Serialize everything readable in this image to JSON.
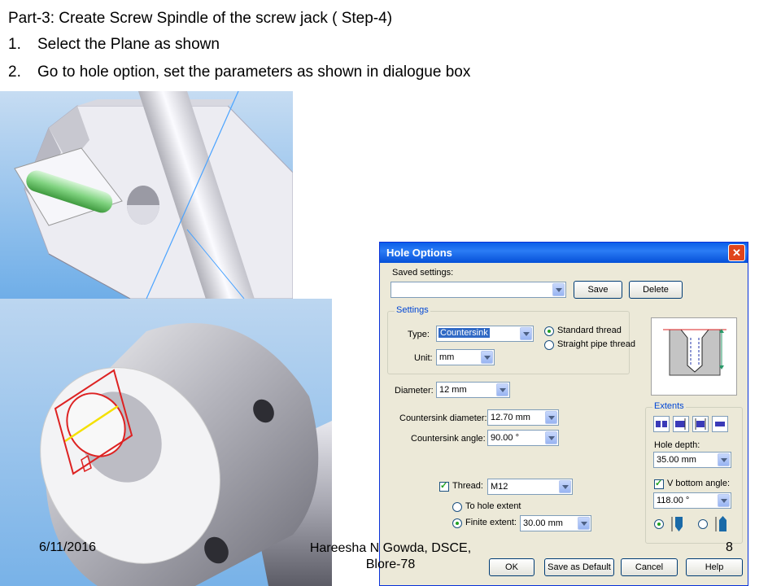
{
  "slide": {
    "title": "Part-3: Create Screw Spindle of the screw jack ( Step-4)",
    "steps": [
      {
        "number": "1.",
        "text": "Select the Plane as shown"
      },
      {
        "number": "2.",
        "text": "Go to hole option, set the parameters as shown in dialogue box"
      }
    ]
  },
  "dialog": {
    "title": "Hole Options",
    "close_glyph": "✕",
    "saved_settings_label": "Saved settings:",
    "saved_settings_value": "",
    "save_button": "Save",
    "delete_button": "Delete",
    "settings_group": "Settings",
    "type_label": "Type:",
    "type_value": "Countersink",
    "standard_thread": "Standard thread",
    "straight_pipe_thread": "Straight pipe thread",
    "thread_mode_selected": "Standard thread",
    "unit_label": "Unit:",
    "unit_value": "mm",
    "diameter_label": "Diameter:",
    "diameter_value": "12 mm",
    "countersink_diameter_label": "Countersink diameter:",
    "countersink_diameter_value": "12.70 mm",
    "countersink_angle_label": "Countersink angle:",
    "countersink_angle_value": "90.00 °",
    "thread_label": "Thread:",
    "thread_checked": true,
    "thread_value": "M12",
    "to_hole_extent": "To hole extent",
    "finite_extent": "Finite extent:",
    "extent_selected": "Finite extent",
    "finite_extent_value": "30.00 mm",
    "extents_group": "Extents",
    "hole_depth_label": "Hole depth:",
    "hole_depth_value": "35.00 mm",
    "v_bottom_label": "V bottom angle:",
    "v_bottom_checked": true,
    "v_bottom_value": "118.00 °",
    "ok_button": "OK",
    "save_default_button": "Save as Default",
    "cancel_button": "Cancel",
    "help_button": "Help"
  },
  "footer": {
    "date": "6/11/2016",
    "author": "Hareesha N Gowda, DSCE, Blore-78",
    "page": "8"
  }
}
